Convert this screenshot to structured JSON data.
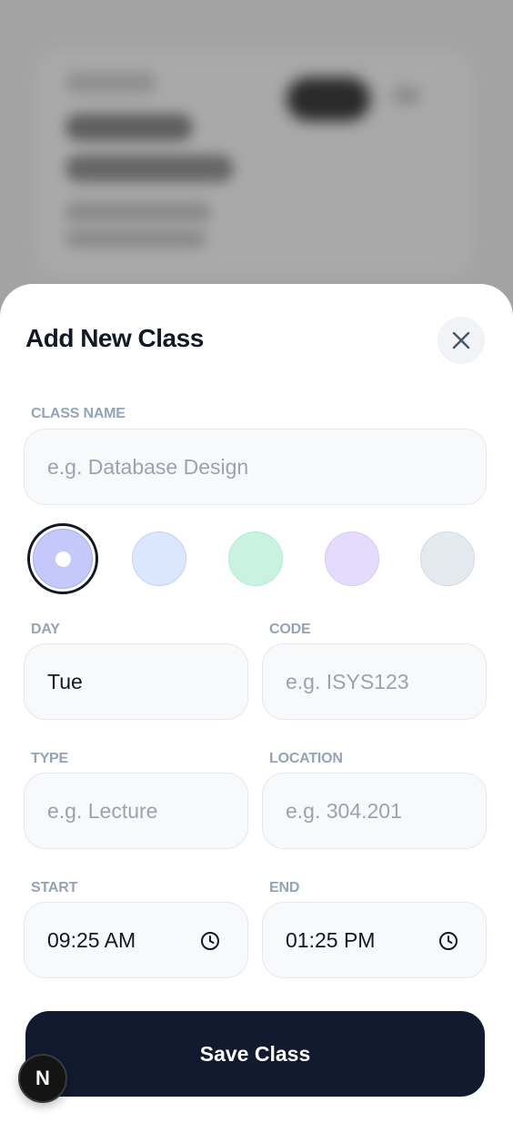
{
  "dialog": {
    "title": "Add New Class",
    "close_icon": "close-icon"
  },
  "form": {
    "class_name": {
      "label": "CLASS NAME",
      "value": "",
      "placeholder": "e.g. Database Design"
    },
    "colors": {
      "selected_index": 0,
      "swatches": [
        "#c5c8fb",
        "#dbe7fd",
        "#c9f2e0",
        "#e5dcfd",
        "#e5e9f0"
      ]
    },
    "day": {
      "label": "DAY",
      "value": "Tue"
    },
    "code": {
      "label": "CODE",
      "value": "",
      "placeholder": "e.g. ISYS123"
    },
    "type": {
      "label": "TYPE",
      "value": "",
      "placeholder": "e.g. Lecture"
    },
    "location": {
      "label": "LOCATION",
      "value": "",
      "placeholder": "e.g. 304.201"
    },
    "start": {
      "label": "START",
      "value": "09:25 AM",
      "icon": "clock-icon"
    },
    "end": {
      "label": "END",
      "value": "01:25 PM",
      "icon": "clock-icon"
    },
    "save_label": "Save Class"
  },
  "badge": {
    "letter": "N"
  }
}
